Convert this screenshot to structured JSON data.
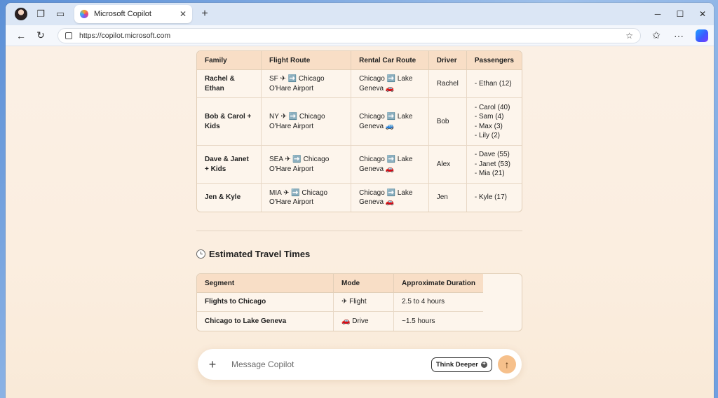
{
  "browser": {
    "tab_title": "Microsoft Copilot",
    "url": "https://copilot.microsoft.com"
  },
  "family_table": {
    "headers": [
      "Family",
      "Flight Route",
      "Rental Car Route",
      "Driver",
      "Passengers"
    ],
    "rows": [
      {
        "family": "Rachel & Ethan",
        "flight": [
          "SF ✈ ➡️ Chicago",
          "O'Hare Airport"
        ],
        "rental": [
          "Chicago ➡️ Lake",
          "Geneva 🚗"
        ],
        "driver": "Rachel",
        "passengers": [
          "- Ethan (12)"
        ]
      },
      {
        "family": "Bob & Carol + Kids",
        "flight": [
          "NY ✈ ➡️ Chicago",
          "O'Hare Airport"
        ],
        "rental": [
          "Chicago ➡️ Lake",
          "Geneva 🚙"
        ],
        "driver": "Bob",
        "passengers": [
          "- Carol (40)",
          "- Sam (4)",
          "- Max (3)",
          "- Lily (2)"
        ]
      },
      {
        "family": "Dave & Janet + Kids",
        "flight": [
          "SEA ✈ ➡️ Chicago",
          "O'Hare Airport"
        ],
        "rental": [
          "Chicago ➡️ Lake",
          "Geneva 🚗"
        ],
        "driver": "Alex",
        "passengers": [
          "- Dave (55)",
          "- Janet (53)",
          "- Mia (21)"
        ]
      },
      {
        "family": "Jen & Kyle",
        "flight": [
          "MIA ✈ ➡️ Chicago",
          "O'Hare Airport"
        ],
        "rental": [
          "Chicago ➡️ Lake",
          "Geneva 🚗"
        ],
        "driver": "Jen",
        "passengers": [
          "- Kyle (17)"
        ]
      }
    ]
  },
  "travel_times": {
    "title": "Estimated Travel Times",
    "headers": [
      "Segment",
      "Mode",
      "Approximate Duration"
    ],
    "rows": [
      {
        "segment": "Flights to Chicago",
        "mode": "✈ Flight",
        "duration": "2.5 to 4 hours"
      },
      {
        "segment": "Chicago to Lake Geneva",
        "mode": "🚗 Drive",
        "duration": "~1.5 hours"
      }
    ]
  },
  "composer": {
    "placeholder": "Message Copilot",
    "think_deeper_label": "Think Deeper"
  }
}
